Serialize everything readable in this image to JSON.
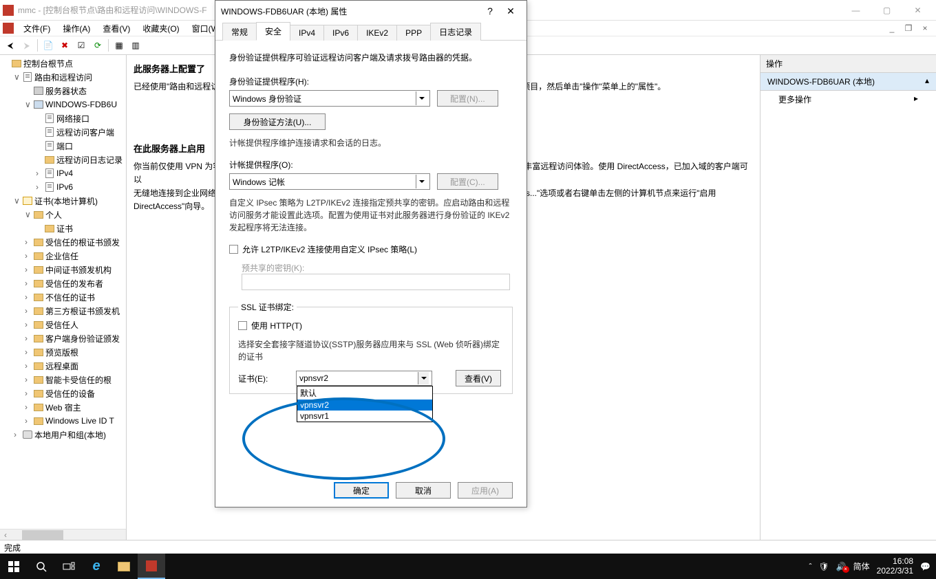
{
  "window": {
    "title": "mmc - [控制台根节点\\路由和远程访问\\WINDOWS-F",
    "status": "完成"
  },
  "menus": [
    "文件(F)",
    "操作(A)",
    "查看(V)",
    "收藏夹(O)",
    "窗口(W)"
  ],
  "tree": {
    "root": "控制台根节点",
    "rras": "路由和远程访问",
    "server_status": "服务器状态",
    "server": "WINDOWS-FDB6U",
    "net_if": "网络接口",
    "ra_clients": "远程访问客户端",
    "ports": "端口",
    "ra_log": "远程访问日志记录",
    "ipv4": "IPv4",
    "ipv6": "IPv6",
    "certs": "证书(本地计算机)",
    "personal": "个人",
    "cert_leaf": "证书",
    "trusted_root": "受信任的根证书颁发",
    "enterprise": "企业信任",
    "intermediate": "中间证书颁发机构",
    "trusted_pub": "受信任的发布者",
    "untrusted": "不信任的证书",
    "third_party": "第三方根证书颁发机",
    "trusted_people": "受信任人",
    "client_auth": "客户端身份验证颁发",
    "preview": "预览版根",
    "remote_desktop": "远程桌面",
    "smartcard": "智能卡受信任的根",
    "trusted_dev": "受信任的设备",
    "web_host": "Web 宿主",
    "winlive": "Windows Live ID T",
    "local_users": "本地用户和组(本地)"
  },
  "main": {
    "h1": "此服务器上配置了",
    "p1": "已经使用\"路由和远程访",
    "p1_tail": "项目，然后单击\"操作\"菜单上的\"属性\"。",
    "h2": "在此服务器上启用",
    "p2a": "你当前仅使用 VPN 为客",
    "p2a_tail": "丰富远程访问体验。使用 DirectAccess，已加入域的客户端可以",
    "p2b": "无缝地连接到企业网络",
    "p2b_tail": "s...\"选项或者右键单击左侧的计算机节点来运行\"启用",
    "p2c": "DirectAccess\"向导。"
  },
  "actions": {
    "header": "操作",
    "sub": "WINDOWS-FDB6UAR (本地)",
    "more": "更多操作"
  },
  "dialog": {
    "title": "WINDOWS-FDB6UAR (本地) 属性",
    "tabs": [
      "常规",
      "安全",
      "IPv4",
      "IPv6",
      "IKEv2",
      "PPP",
      "日志记录"
    ],
    "intro": "身份验证提供程序可验证远程访问客户端及请求拨号路由器的凭据。",
    "auth_provider_label": "身份验证提供程序(H):",
    "auth_provider_value": "Windows 身份验证",
    "configure_n": "配置(N)...",
    "auth_method": "身份验证方法(U)...",
    "acct_desc": "计帐提供程序维护连接请求和会话的日志。",
    "acct_provider_label": "计帐提供程序(O):",
    "acct_provider_value": "Windows 记帐",
    "configure_c": "配置(C)...",
    "ipsec_desc": "自定义 IPsec 策略为 L2TP/IKEv2 连接指定预共享的密钥。应启动路由和远程访问服务才能设置此选项。配置为使用证书对此服务器进行身份验证的 IKEv2 发起程序将无法连接。",
    "allow_ipsec": "允许 L2TP/IKEv2 连接使用自定义 IPsec 策略(L)",
    "preshared_key": "预共享的密钥(K):",
    "ssl_legend": "SSL 证书绑定:",
    "use_http": "使用 HTTP(T)",
    "ssl_desc": "选择安全套接字隧道协议(SSTP)服务器应用来与 SSL (Web 侦听器)绑定的证书",
    "cert_label": "证书(E):",
    "cert_value": "vpnsvr2",
    "view": "查看(V)",
    "options": [
      "默认",
      "vpnsvr2",
      "vpnsvr1"
    ],
    "ok": "确定",
    "cancel": "取消",
    "apply": "应用(A)"
  },
  "taskbar": {
    "ime": "简体",
    "time": "16:08",
    "date": "2022/3/31"
  }
}
